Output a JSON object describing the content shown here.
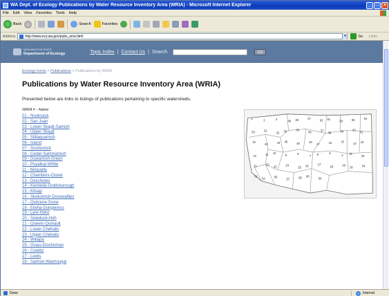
{
  "window": {
    "title": "WA Dept. of Ecology Publications by Water Resource Inventory Area (WRIA) - Microsoft Internet Explorer",
    "min": "_",
    "max": "□",
    "close": "×"
  },
  "menu": [
    "File",
    "Edit",
    "View",
    "Favorites",
    "Tools",
    "Help"
  ],
  "toolbar": {
    "back": "Back",
    "search": "Search",
    "favorites": "Favorites"
  },
  "address": {
    "label": "Address",
    "url": "http://www.ecy.wa.gov/pubs_wria.html",
    "go": "Go",
    "links": "Links"
  },
  "agency": {
    "state_line": "WASHINGTON STATE",
    "name": "Department of Ecology",
    "nav_topic": "Topic Index",
    "nav_sep1": "|",
    "nav_contact": "Contact Us",
    "nav_sep2": "|",
    "nav_search": "Search",
    "search_button": "GO"
  },
  "breadcrumb": {
    "home": "Ecology home",
    "sep1": ">",
    "pubs": "Publications",
    "sep2": ">",
    "current": "Publications by WRIA"
  },
  "page": {
    "title": "Publications by Water Resource Inventory Area (WRIA)",
    "intro": "Presented below are links to listings of publications pertaining to specific watersheds.",
    "list_header": "WRIA # - Name"
  },
  "wrias": [
    "01 - Nooksack",
    "02 - San Juan",
    "03 - Lower Skagit-Samish",
    "04 - Upper Skagit",
    "05 - Stillaguamish",
    "06 - Island",
    "07 - Snohomish",
    "08 - Cedar-Sammamish",
    "09 - Duwamish-Green",
    "10 - Puyallup-White",
    "11 - Nisqually",
    "12 - Chambers-Clover",
    "13 - Deschutes",
    "14 - Kennedy-Goldsborough",
    "15 - Kitsap",
    "16 - Skokomish-Dosewallips",
    "17 - Quilcene-Snow",
    "18 - Elwha-Dungeness",
    "19 - Lyre-Hoko",
    "20 - Soleduck-Hoh",
    "21 - Queets-Quinault",
    "22 - Lower Chehalis",
    "23 - Upper Chehalis",
    "24 - Willapa",
    "25 - Grays-Elochoman",
    "26 - Cowlitz",
    "27 - Lewis",
    "28 - Salmon-Washougal"
  ],
  "map_labels": [
    "1",
    "3",
    "4",
    "49",
    "48",
    "47",
    "62",
    "61",
    "59",
    "55",
    "54",
    "53",
    "31",
    "32",
    "33",
    "35",
    "36",
    "37",
    "38",
    "39",
    "40",
    "41",
    "42",
    "43",
    "44",
    "45",
    "46",
    "18",
    "17",
    "16",
    "15",
    "14",
    "13",
    "12",
    "11",
    "10",
    "9",
    "8",
    "7",
    "6",
    "5",
    "2",
    "19",
    "20",
    "21",
    "22",
    "23",
    "24",
    "25",
    "26",
    "27",
    "28",
    "29",
    "30",
    "34",
    "51",
    "52",
    "56",
    "57",
    "58",
    "60",
    "50"
  ],
  "status": {
    "text": "Done",
    "zone": "Internet"
  },
  "colors": {
    "header_bar": "#5c7aa0",
    "link": "#3e6cb8",
    "titlebar": "#0a3ab8"
  }
}
